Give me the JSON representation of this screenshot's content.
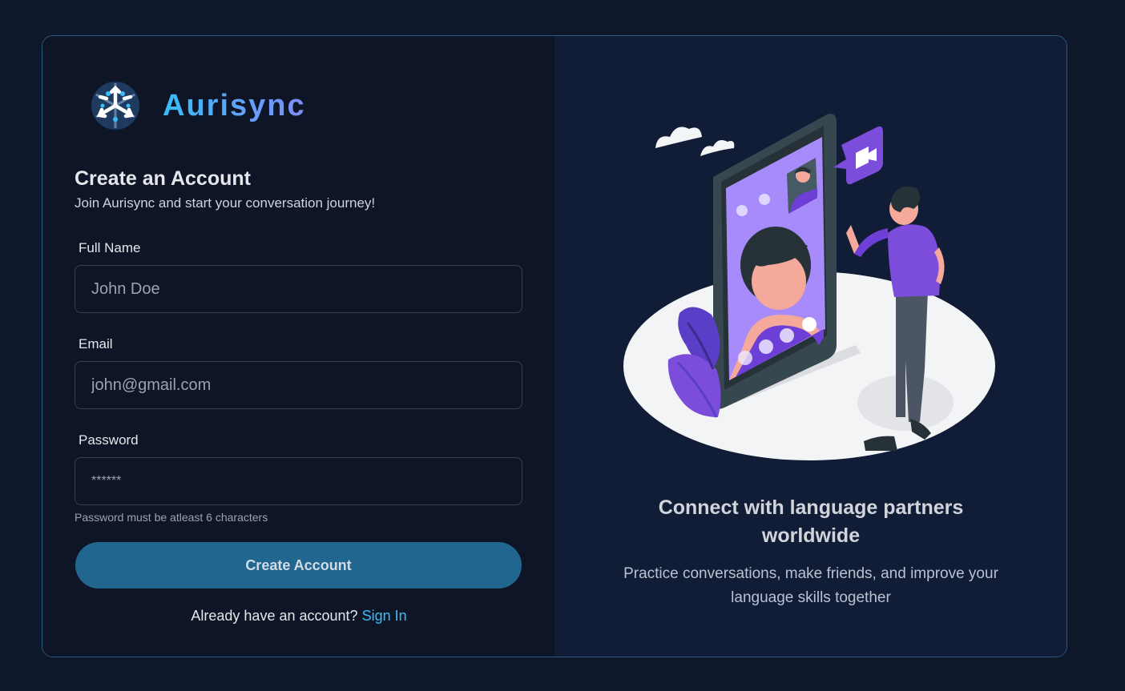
{
  "brand": {
    "name": "Aurisync",
    "logo_icon": "snowflake-network-icon"
  },
  "form": {
    "title": "Create an Account",
    "subtitle": "Join Aurisync and start your conversation journey!",
    "full_name": {
      "label": "Full Name",
      "placeholder": "John Doe",
      "value": ""
    },
    "email": {
      "label": "Email",
      "placeholder": "john@gmail.com",
      "value": ""
    },
    "password": {
      "label": "Password",
      "placeholder": "******",
      "value": ""
    },
    "password_hint": "Password must be atleast 6 characters",
    "submit_label": "Create Account",
    "signin_prompt": "Already have an account?",
    "signin_link": "Sign In"
  },
  "promo": {
    "illustration": "video-call-illustration",
    "title": "Connect with language partners worldwide",
    "text": "Practice conversations, make friends, and improve your language skills together"
  },
  "colors": {
    "background": "#0f172a",
    "card_left": "#0d1526",
    "card_right": "#111d36",
    "accent": "#38bdf8",
    "button": "#21668e",
    "illustration_purple": "#7c4ddb"
  }
}
